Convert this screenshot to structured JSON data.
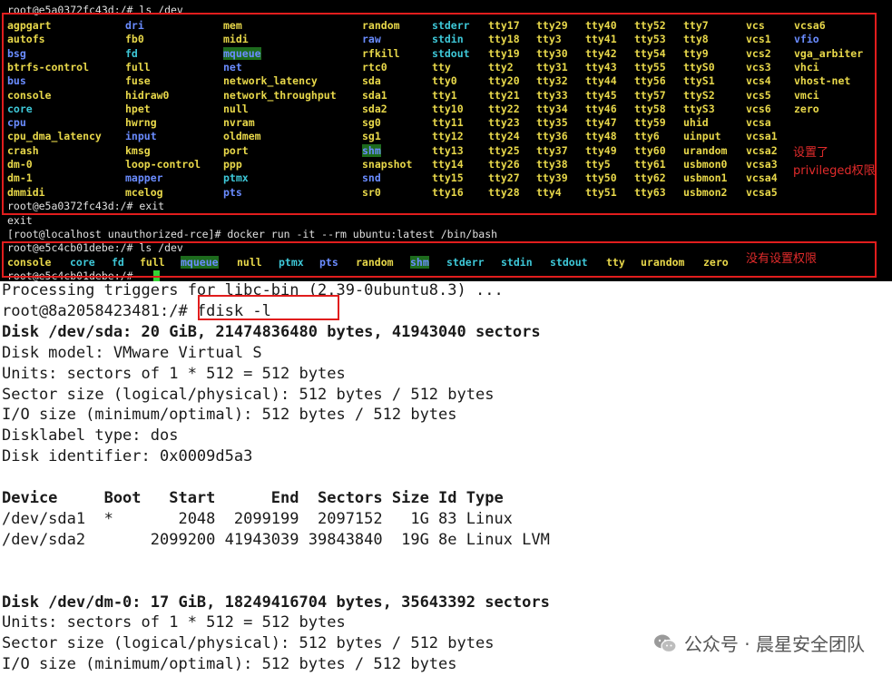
{
  "top": {
    "prompt_ls_privileged": "root@e5a0372fc43d:/# ls /dev",
    "dev_listing_privileged": [
      [
        [
          "agpgart",
          "dev"
        ],
        [
          "dri",
          "dir"
        ],
        [
          "mem",
          "dev"
        ],
        [
          "random",
          "dev"
        ],
        [
          "stderr",
          "link"
        ],
        [
          "tty17",
          "dev"
        ],
        [
          "tty29",
          "dev"
        ],
        [
          "tty40",
          "dev"
        ],
        [
          "tty52",
          "dev"
        ],
        [
          "tty7",
          "dev"
        ],
        [
          "vcs",
          "dev"
        ],
        [
          "vcsa6",
          "dev"
        ]
      ],
      [
        [
          "autofs",
          "dev"
        ],
        [
          "fb0",
          "dev"
        ],
        [
          "midi",
          "dev"
        ],
        [
          "raw",
          "dir"
        ],
        [
          "stdin",
          "link"
        ],
        [
          "tty18",
          "dev"
        ],
        [
          "tty3",
          "dev"
        ],
        [
          "tty41",
          "dev"
        ],
        [
          "tty53",
          "dev"
        ],
        [
          "tty8",
          "dev"
        ],
        [
          "vcs1",
          "dev"
        ],
        [
          "vfio",
          "dir"
        ]
      ],
      [
        [
          "bsg",
          "dir"
        ],
        [
          "fd",
          "link"
        ],
        [
          "mqueue",
          "hl"
        ],
        [
          "rfkill",
          "dev"
        ],
        [
          "stdout",
          "link"
        ],
        [
          "tty19",
          "dev"
        ],
        [
          "tty30",
          "dev"
        ],
        [
          "tty42",
          "dev"
        ],
        [
          "tty54",
          "dev"
        ],
        [
          "tty9",
          "dev"
        ],
        [
          "vcs2",
          "dev"
        ],
        [
          "vga_arbiter",
          "dev"
        ]
      ],
      [
        [
          "btrfs-control",
          "dev"
        ],
        [
          "full",
          "dev"
        ],
        [
          "net",
          "dir"
        ],
        [
          "rtc0",
          "dev"
        ],
        [
          "tty",
          "dev"
        ],
        [
          "tty2",
          "dev"
        ],
        [
          "tty31",
          "dev"
        ],
        [
          "tty43",
          "dev"
        ],
        [
          "tty55",
          "dev"
        ],
        [
          "ttyS0",
          "dev"
        ],
        [
          "vcs3",
          "dev"
        ],
        [
          "vhci",
          "dev"
        ]
      ],
      [
        [
          "bus",
          "dir"
        ],
        [
          "fuse",
          "dev"
        ],
        [
          "network_latency",
          "dev"
        ],
        [
          "sda",
          "dev"
        ],
        [
          "tty0",
          "dev"
        ],
        [
          "tty20",
          "dev"
        ],
        [
          "tty32",
          "dev"
        ],
        [
          "tty44",
          "dev"
        ],
        [
          "tty56",
          "dev"
        ],
        [
          "ttyS1",
          "dev"
        ],
        [
          "vcs4",
          "dev"
        ],
        [
          "vhost-net",
          "dev"
        ]
      ],
      [
        [
          "console",
          "dev"
        ],
        [
          "hidraw0",
          "dev"
        ],
        [
          "network_throughput",
          "dev"
        ],
        [
          "sda1",
          "dev"
        ],
        [
          "tty1",
          "dev"
        ],
        [
          "tty21",
          "dev"
        ],
        [
          "tty33",
          "dev"
        ],
        [
          "tty45",
          "dev"
        ],
        [
          "tty57",
          "dev"
        ],
        [
          "ttyS2",
          "dev"
        ],
        [
          "vcs5",
          "dev"
        ],
        [
          "vmci",
          "dev"
        ]
      ],
      [
        [
          "core",
          "link"
        ],
        [
          "hpet",
          "dev"
        ],
        [
          "null",
          "dev"
        ],
        [
          "sda2",
          "dev"
        ],
        [
          "tty10",
          "dev"
        ],
        [
          "tty22",
          "dev"
        ],
        [
          "tty34",
          "dev"
        ],
        [
          "tty46",
          "dev"
        ],
        [
          "tty58",
          "dev"
        ],
        [
          "ttyS3",
          "dev"
        ],
        [
          "vcs6",
          "dev"
        ],
        [
          "zero",
          "dev"
        ]
      ],
      [
        [
          "cpu",
          "dir"
        ],
        [
          "hwrng",
          "dev"
        ],
        [
          "nvram",
          "dev"
        ],
        [
          "sg0",
          "dev"
        ],
        [
          "tty11",
          "dev"
        ],
        [
          "tty23",
          "dev"
        ],
        [
          "tty35",
          "dev"
        ],
        [
          "tty47",
          "dev"
        ],
        [
          "tty59",
          "dev"
        ],
        [
          "uhid",
          "dev"
        ],
        [
          "vcsa",
          "dev"
        ],
        [
          "",
          ""
        ]
      ],
      [
        [
          "cpu_dma_latency",
          "dev"
        ],
        [
          "input",
          "dir"
        ],
        [
          "oldmem",
          "dev"
        ],
        [
          "sg1",
          "dev"
        ],
        [
          "tty12",
          "dev"
        ],
        [
          "tty24",
          "dev"
        ],
        [
          "tty36",
          "dev"
        ],
        [
          "tty48",
          "dev"
        ],
        [
          "tty6",
          "dev"
        ],
        [
          "uinput",
          "dev"
        ],
        [
          "vcsa1",
          "dev"
        ],
        [
          "",
          ""
        ]
      ],
      [
        [
          "crash",
          "dev"
        ],
        [
          "kmsg",
          "dev"
        ],
        [
          "port",
          "dev"
        ],
        [
          "shm",
          "hl"
        ],
        [
          "tty13",
          "dev"
        ],
        [
          "tty25",
          "dev"
        ],
        [
          "tty37",
          "dev"
        ],
        [
          "tty49",
          "dev"
        ],
        [
          "tty60",
          "dev"
        ],
        [
          "urandom",
          "dev"
        ],
        [
          "vcsa2",
          "dev"
        ],
        [
          "",
          ""
        ]
      ],
      [
        [
          "dm-0",
          "dev"
        ],
        [
          "loop-control",
          "dev"
        ],
        [
          "ppp",
          "dev"
        ],
        [
          "snapshot",
          "dev"
        ],
        [
          "tty14",
          "dev"
        ],
        [
          "tty26",
          "dev"
        ],
        [
          "tty38",
          "dev"
        ],
        [
          "tty5",
          "dev"
        ],
        [
          "tty61",
          "dev"
        ],
        [
          "usbmon0",
          "dev"
        ],
        [
          "vcsa3",
          "dev"
        ],
        [
          "",
          ""
        ]
      ],
      [
        [
          "dm-1",
          "dev"
        ],
        [
          "mapper",
          "dir"
        ],
        [
          "ptmx",
          "link"
        ],
        [
          "snd",
          "dir"
        ],
        [
          "tty15",
          "dev"
        ],
        [
          "tty27",
          "dev"
        ],
        [
          "tty39",
          "dev"
        ],
        [
          "tty50",
          "dev"
        ],
        [
          "tty62",
          "dev"
        ],
        [
          "usbmon1",
          "dev"
        ],
        [
          "vcsa4",
          "dev"
        ],
        [
          "",
          ""
        ]
      ],
      [
        [
          "dmmidi",
          "dev"
        ],
        [
          "mcelog",
          "dev"
        ],
        [
          "pts",
          "dir"
        ],
        [
          "sr0",
          "dev"
        ],
        [
          "tty16",
          "dev"
        ],
        [
          "tty28",
          "dev"
        ],
        [
          "tty4",
          "dev"
        ],
        [
          "tty51",
          "dev"
        ],
        [
          "tty63",
          "dev"
        ],
        [
          "usbmon2",
          "dev"
        ],
        [
          "vcsa5",
          "dev"
        ],
        [
          "",
          ""
        ]
      ]
    ],
    "prompt_exit": "root@e5a0372fc43d:/# exit",
    "exit_echo": "exit",
    "docker_cmd": "[root@localhost unauthorized-rce]# docker run -it --rm ubuntu:latest /bin/bash",
    "prompt_ls_normal": "root@e5c4cb01debe:/# ls /dev",
    "dev_listing_normal": [
      [
        "console",
        "dev"
      ],
      [
        "core",
        "link"
      ],
      [
        "fd",
        "link"
      ],
      [
        "full",
        "dev"
      ],
      [
        "mqueue",
        "hl"
      ],
      [
        "null",
        "dev"
      ],
      [
        "ptmx",
        "link"
      ],
      [
        "pts",
        "dir"
      ],
      [
        "random",
        "dev"
      ],
      [
        "shm",
        "hl"
      ],
      [
        "stderr",
        "link"
      ],
      [
        "stdin",
        "link"
      ],
      [
        "stdout",
        "link"
      ],
      [
        "tty",
        "dev"
      ],
      [
        "urandom",
        "dev"
      ],
      [
        "zero",
        "dev"
      ]
    ],
    "prompt_final": "root@e5c4cb01debe:/# ",
    "note_privileged_line1": "设置了",
    "note_privileged_line2": "privileged权限",
    "note_normal": "没有设置权限"
  },
  "bottom": {
    "lines": [
      {
        "text": "Processing triggers for libc-bin (2.39-0ubuntu8.3) ...",
        "bold": false
      },
      {
        "text": "root@8a2058423481:/# fdisk -l",
        "bold": false
      },
      {
        "text": "Disk /dev/sda: 20 GiB, 21474836480 bytes, 41943040 sectors",
        "bold": true
      },
      {
        "text": "Disk model: VMware Virtual S",
        "bold": false
      },
      {
        "text": "Units: sectors of 1 * 512 = 512 bytes",
        "bold": false
      },
      {
        "text": "Sector size (logical/physical): 512 bytes / 512 bytes",
        "bold": false
      },
      {
        "text": "I/O size (minimum/optimal): 512 bytes / 512 bytes",
        "bold": false
      },
      {
        "text": "Disklabel type: dos",
        "bold": false
      },
      {
        "text": "Disk identifier: 0x0009d5a3",
        "bold": false
      },
      {
        "text": "",
        "bold": false
      },
      {
        "text": "Device     Boot   Start      End  Sectors Size Id Type",
        "bold": true
      },
      {
        "text": "/dev/sda1  *       2048  2099199  2097152   1G 83 Linux",
        "bold": false
      },
      {
        "text": "/dev/sda2       2099200 41943039 39843840  19G 8e Linux LVM",
        "bold": false
      },
      {
        "text": "",
        "bold": false
      },
      {
        "text": "",
        "bold": false
      },
      {
        "text": "Disk /dev/dm-0: 17 GiB, 18249416704 bytes, 35643392 sectors",
        "bold": true
      },
      {
        "text": "Units: sectors of 1 * 512 = 512 bytes",
        "bold": false
      },
      {
        "text": "Sector size (logical/physical): 512 bytes / 512 bytes",
        "bold": false
      },
      {
        "text": "I/O size (minimum/optimal): 512 bytes / 512 bytes",
        "bold": false
      }
    ],
    "watermark": "公众号 · 晨星安全团队"
  },
  "colors": {
    "dir": "#6a8cff",
    "dev": "#e8d84a",
    "link": "#3ec8d8",
    "highlight_bg": "#1d6b1d",
    "annotation_red": "#e11d1d"
  },
  "icons": {
    "watermark": "wechat-icon",
    "cursor": "terminal-cursor"
  }
}
